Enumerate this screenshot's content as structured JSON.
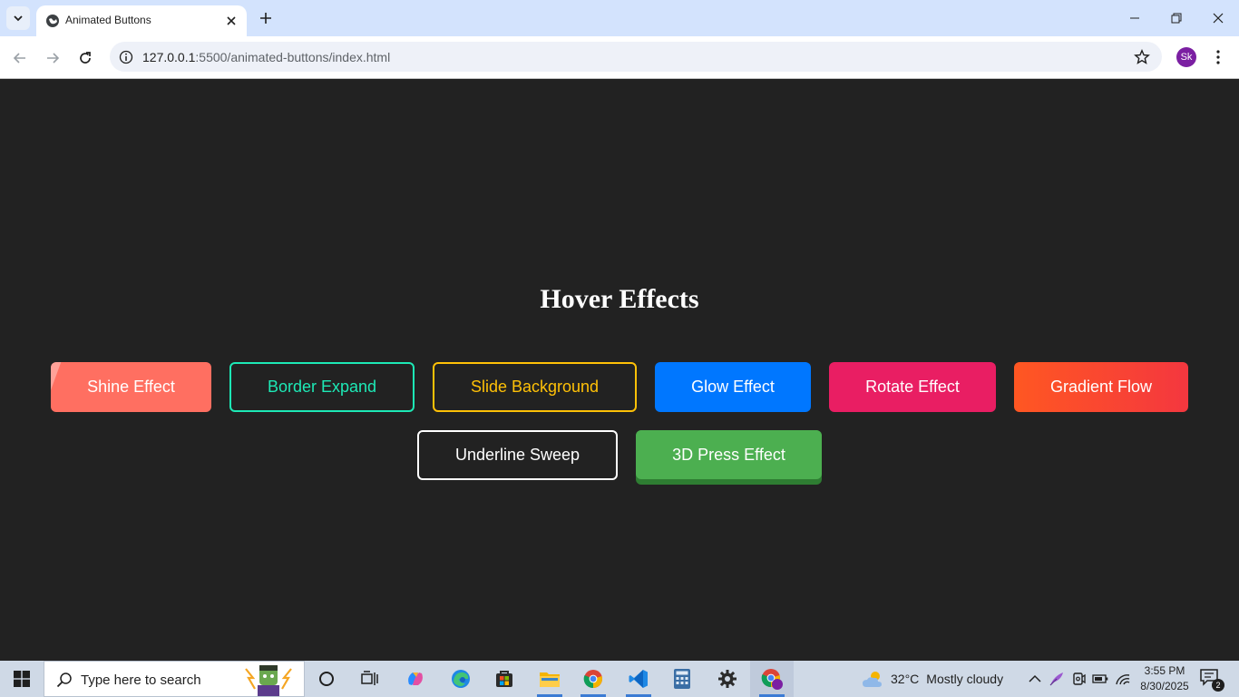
{
  "browser": {
    "tab_title": "Animated Buttons",
    "url_host": "127.0.0.1",
    "url_rest": ":5500/animated-buttons/index.html",
    "profile_initials": "Sk"
  },
  "page": {
    "heading": "Hover Effects",
    "buttons": [
      {
        "label": "Shine Effect",
        "color": "#ff6f61"
      },
      {
        "label": "Border Expand",
        "color": "#1de9b6"
      },
      {
        "label": "Slide Background",
        "color": "#ffc107"
      },
      {
        "label": "Glow Effect",
        "color": "#0077ff"
      },
      {
        "label": "Rotate Effect",
        "color": "#e91e63"
      },
      {
        "label": "Gradient Flow",
        "color": "#ff5722"
      },
      {
        "label": "Underline Sweep",
        "color": "#ffffff"
      },
      {
        "label": "3D Press Effect",
        "color": "#4caf50"
      }
    ]
  },
  "taskbar": {
    "search_placeholder": "Type here to search",
    "weather_temp": "32°C",
    "weather_condition": "Mostly cloudy",
    "time": "3:55 PM",
    "date": "8/30/2025",
    "notification_count": "2"
  }
}
